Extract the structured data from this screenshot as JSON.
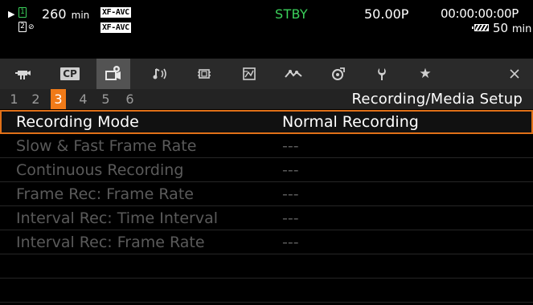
{
  "status": {
    "play_symbol": "▶",
    "slot1_number": "1",
    "slot2_number": "2",
    "slot2_mark": "⊘",
    "remaining_value": "260",
    "remaining_unit": "min",
    "format_slot1": "XF-AVC",
    "format_slot2": "XF-AVC",
    "mode": "STBY",
    "frame_rate": "50.00P",
    "timecode": "00:00:00:00P",
    "battery_value": "50",
    "battery_unit": "min",
    "colors": {
      "mode": "#3bd15b",
      "slot1": "#3bd15b"
    }
  },
  "tabs": [
    {
      "name": "camera-tab",
      "icon": "camera-icon"
    },
    {
      "name": "custom-picture-tab",
      "label": "CP",
      "icon": "custom-picture-icon"
    },
    {
      "name": "recording-setup-tab",
      "icon": "recording-setup-icon",
      "active": true
    },
    {
      "name": "audio-tab",
      "icon": "audio-icon"
    },
    {
      "name": "monitoring-tab",
      "icon": "monitor-icon"
    },
    {
      "name": "assistance-tab",
      "icon": "assistance-icon"
    },
    {
      "name": "network-tab",
      "icon": "network-icon"
    },
    {
      "name": "system-tab",
      "icon": "system-icon"
    },
    {
      "name": "wrench-tab",
      "icon": "wrench-icon"
    },
    {
      "name": "my-menu-tab",
      "icon": "star-icon"
    },
    {
      "name": "close-tab",
      "icon": "close-icon"
    }
  ],
  "pages": {
    "numbers": [
      "1",
      "2",
      "3",
      "4",
      "5",
      "6"
    ],
    "active": "3",
    "accent_color": "#f07a18"
  },
  "menu_title": "Recording/Media Setup",
  "settings": [
    {
      "name": "Recording Mode",
      "value": "Normal Recording",
      "selected": true
    },
    {
      "name": "Slow & Fast Frame Rate",
      "value": "---"
    },
    {
      "name": "Continuous Recording",
      "value": "---"
    },
    {
      "name": "Frame Rec: Frame Rate",
      "value": "---"
    },
    {
      "name": "Interval Rec: Time Interval",
      "value": "---"
    },
    {
      "name": "Interval Rec: Frame Rate",
      "value": "---"
    }
  ],
  "cp_label": "CP"
}
